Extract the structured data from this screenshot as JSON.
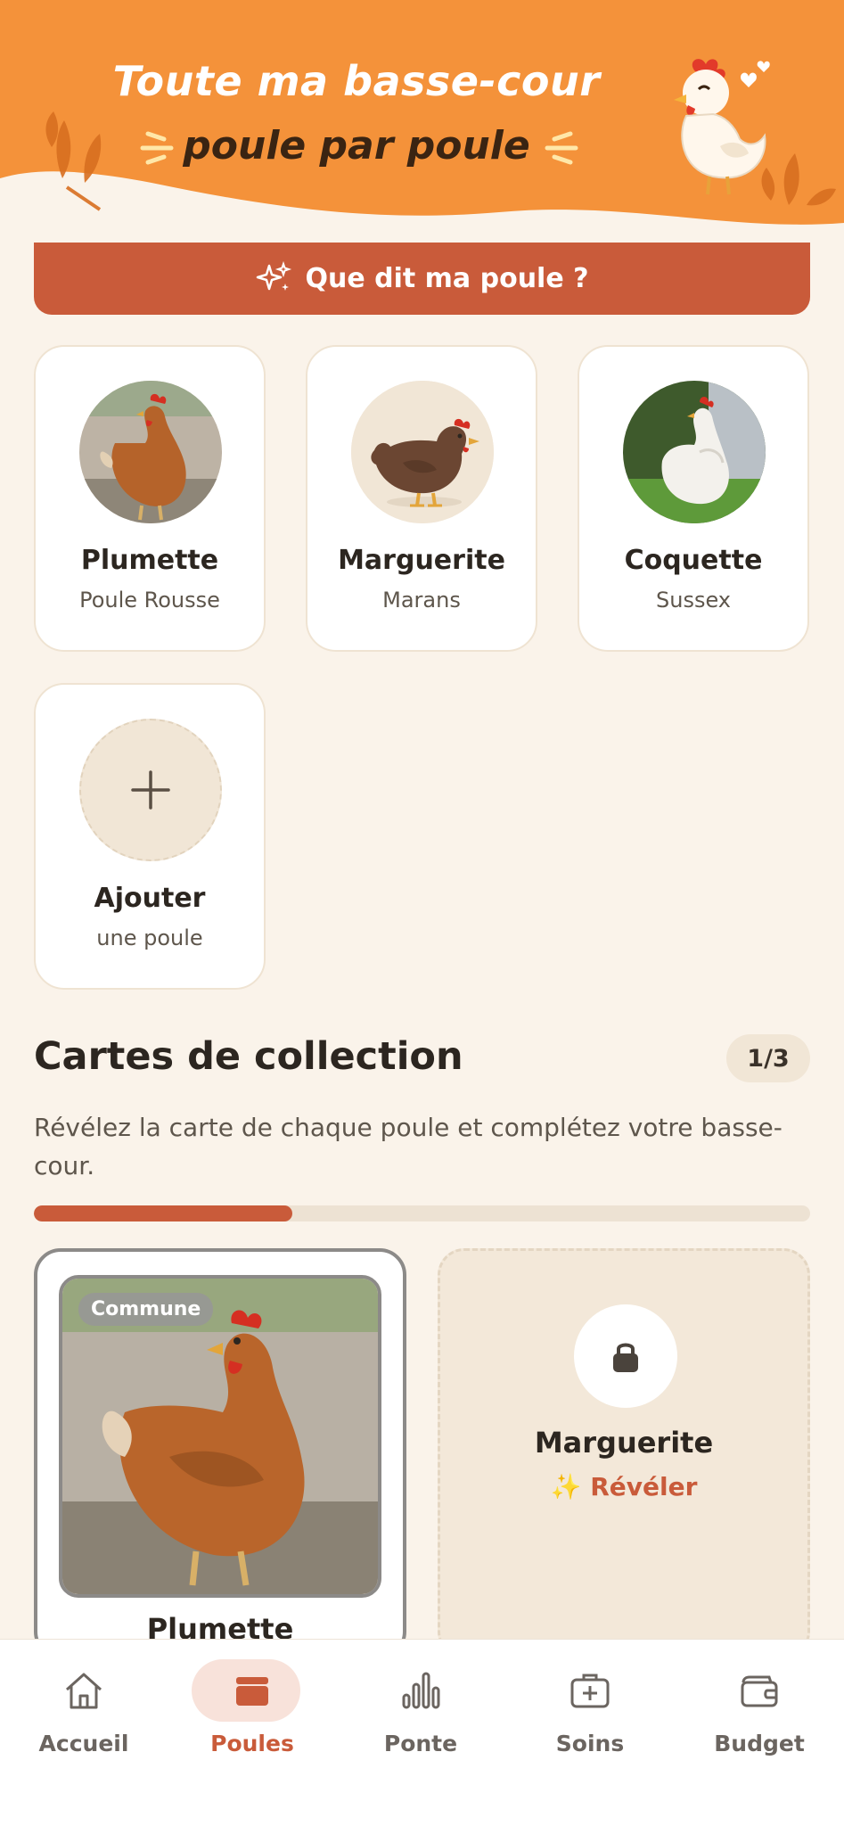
{
  "header": {
    "title_line1": "Toute ma basse-cour",
    "title_line2": "poule par poule"
  },
  "ask_button": {
    "label": "Que dit ma poule ?",
    "icon": "sparkles-icon"
  },
  "hens": [
    {
      "name": "Plumette",
      "breed": "Poule Rousse",
      "avatar": "rust-hen-photo"
    },
    {
      "name": "Marguerite",
      "breed": "Marans",
      "avatar": "brown-hen-illustration"
    },
    {
      "name": "Coquette",
      "breed": "Sussex",
      "avatar": "white-hen-photo"
    }
  ],
  "add_card": {
    "title": "Ajouter",
    "subtitle": "une poule",
    "icon": "plus-icon"
  },
  "collection": {
    "title": "Cartes de collection",
    "count": "1/3",
    "description": "Révélez la carte de chaque poule et complétez votre basse-cour.",
    "progress": 0.333,
    "cards": [
      {
        "name": "Plumette",
        "rarity": "Commune",
        "revealed": true
      },
      {
        "name": "Marguerite",
        "reveal_label": "✨ Révéler",
        "revealed": false
      }
    ]
  },
  "colors": {
    "accent": "#C95B3A",
    "header": "#F4923A",
    "background": "#FAF3EA"
  },
  "nav": {
    "items": [
      {
        "label": "Accueil",
        "icon": "home-icon"
      },
      {
        "label": "Poules",
        "icon": "coop-icon",
        "active": true
      },
      {
        "label": "Ponte",
        "icon": "bar-chart-icon"
      },
      {
        "label": "Soins",
        "icon": "medical-kit-icon"
      },
      {
        "label": "Budget",
        "icon": "wallet-icon"
      }
    ]
  }
}
